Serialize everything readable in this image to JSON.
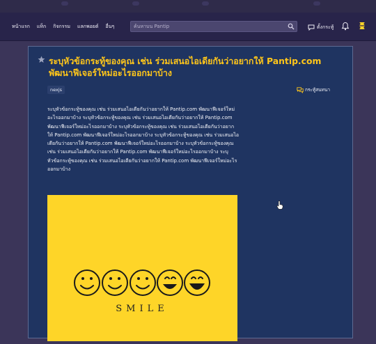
{
  "nav": {
    "links": [
      "หน้าแรก",
      "แท็ก",
      "กิจกรรม",
      "แลกพอยต์",
      "อื่นๆ"
    ],
    "search_placeholder": "ค้นหาบน Pantip",
    "forum_label": "ตั้งกระทู้"
  },
  "post": {
    "title": "ระบุหัวข้อกระทู้ของคุณ เช่น ร่วมเสนอไอเดียกันว่าอยากให้ Pantip.com พัฒนาฟีเจอร์ใหม่อะไรออกมาบ้าง",
    "tag": "nexjs",
    "discuss_label": "กระทู้สนทนา",
    "body": "ระบุหัวข้อกระทู้ของคุณ เช่น ร่วมเสนอไอเดียกันว่าอยากให้ Pantip.com พัฒนาฟีเจอร์ใหม่อะไรออกมาบ้าง ระบุหัวข้อกระทู้ของคุณ เช่น ร่วมเสนอไอเดียกันว่าอยากให้ Pantip.com พัฒนาฟีเจอร์ใหม่อะไรออกมาบ้าง ระบุหัวข้อกระทู้ของคุณ เช่น ร่วมเสนอไอเดียกันว่าอยากให้ Pantip.com พัฒนาฟีเจอร์ใหม่อะไรออกมาบ้าง ระบุหัวข้อกระทู้ของคุณ เช่น ร่วมเสนอไอเดียกันว่าอยากให้ Pantip.com พัฒนาฟีเจอร์ใหม่อะไรออกมาบ้าง ระบุหัวข้อกระทู้ของคุณ เช่น ร่วมเสนอไอเดียกันว่าอยากให้ Pantip.com พัฒนาฟีเจอร์ใหม่อะไรออกมาบ้าง ระบุหัวข้อกระทู้ของคุณ เช่น ร่วมเสนอไอเดียกันว่าอยากให้ Pantip.com พัฒนาฟีเจอร์ใหม่อะไรออกมาบ้าง",
    "image_text": "SMILE"
  },
  "colors": {
    "title": "#ffc61a",
    "card": "#1f3461",
    "image_bg": "#fed528"
  }
}
